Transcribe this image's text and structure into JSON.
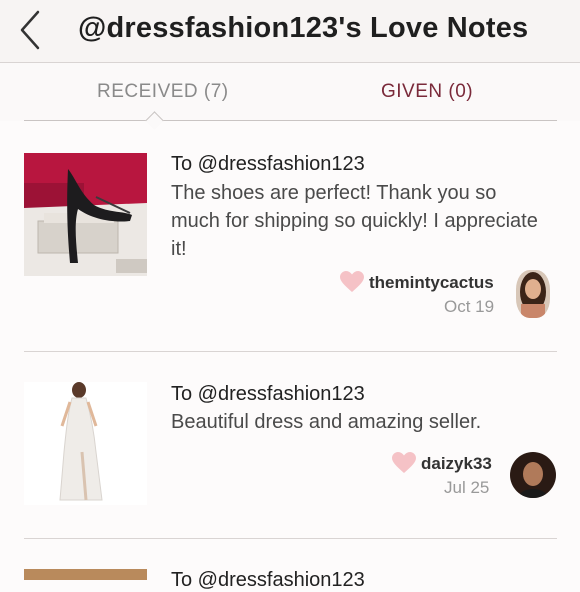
{
  "header": {
    "title": "@dressfashion123's Love Notes",
    "back_icon": "chevron-left-icon"
  },
  "tabs": [
    {
      "label": "RECEIVED (7)",
      "active": true
    },
    {
      "label": "GIVEN (0)",
      "active": false
    }
  ],
  "notes": [
    {
      "to": "To @dressfashion123",
      "message": "The shoes are perfect! Thank you so much for shipping so quickly! I appreciate it!",
      "username": "themintycactus",
      "date": "Oct 19",
      "item": "black pointed-toe pumps"
    },
    {
      "to": "To @dressfashion123",
      "message": "Beautiful dress and amazing seller.",
      "username": "daizyk33",
      "date": "Jul 25",
      "item": "white lace slit maxi dress"
    },
    {
      "to": "To @dressfashion123",
      "message": "",
      "username": "",
      "date": ""
    }
  ],
  "colors": {
    "heart": "#f5c2c6",
    "given_tab": "#7a2a3a",
    "received_tab": "#8a8a8a"
  }
}
